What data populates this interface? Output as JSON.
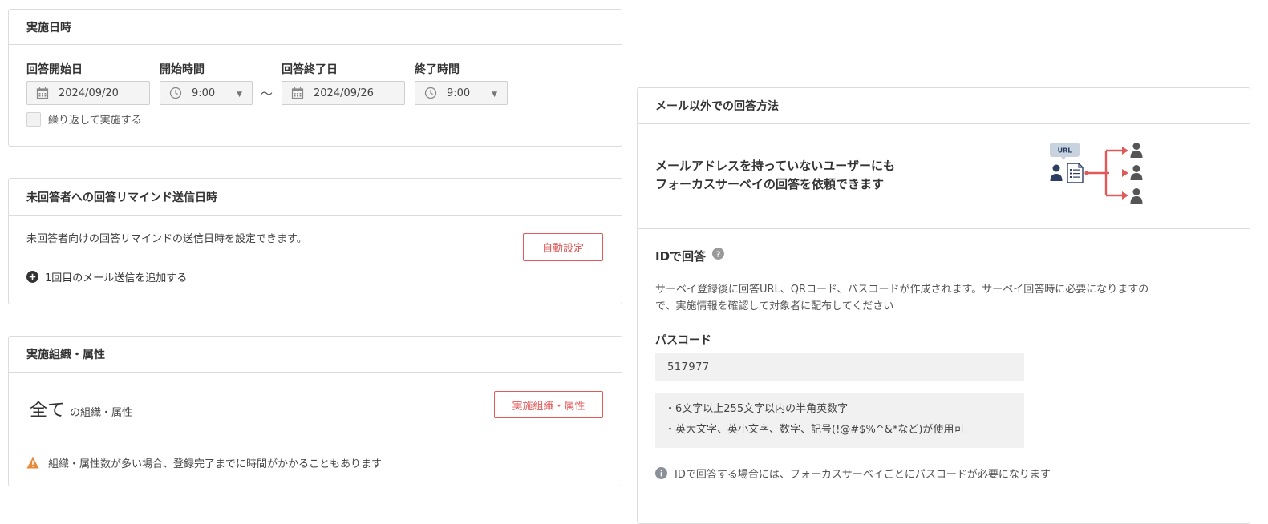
{
  "schedule": {
    "title": "実施日時",
    "start_date_label": "回答開始日",
    "start_date_value": "2024/09/20",
    "start_time_label": "開始時間",
    "start_time_value": "9:00",
    "tilde": "〜",
    "end_date_label": "回答終了日",
    "end_date_value": "2024/09/26",
    "end_time_label": "終了時間",
    "end_time_value": "9:00",
    "repeat_label": "繰り返して実施する"
  },
  "reminder": {
    "title": "未回答者への回答リマインド送信日時",
    "description": "未回答者向けの回答リマインドの送信日時を設定できます。",
    "auto_button": "自動設定",
    "add_link": "1回目のメール送信を追加する"
  },
  "org": {
    "title": "実施組織・属性",
    "all_big": "全て",
    "all_suffix": "の組織・属性",
    "button": "実施組織・属性",
    "warning": "組織・属性数が多い場合、登録完了までに時間がかかることもあります"
  },
  "non_email": {
    "title": "メール以外での回答方法",
    "headline_line1": "メールアドレスを持っていないユーザーにも",
    "headline_line2": "フォーカスサーベイの回答を依頼できます",
    "illustration_url_tag": "URL",
    "id_answer_title": "IDで回答",
    "id_desc_line1": "サーベイ登録後に回答URL、QRコード、パスコードが作成されます。サーベイ回答時に必要になりますの",
    "id_desc_line2": "で、実施情報を確認して対象者に配布してください",
    "passcode_label": "パスコード",
    "passcode_value": "517977",
    "rule1": "・6文字以上255文字以内の半角英数字",
    "rule2": "・英大文字、英小文字、数字、記号(!@#$%^&*など)が使用可",
    "info": "IDで回答する場合には、フォーカスサーベイごとにパスコードが必要になります"
  },
  "colors": {
    "accent_red": "#e05a5a",
    "warning_orange": "#e8893a",
    "info_gray": "#8a8f99",
    "border": "#dcdcdc",
    "illustration_navy": "#2d3e63"
  }
}
